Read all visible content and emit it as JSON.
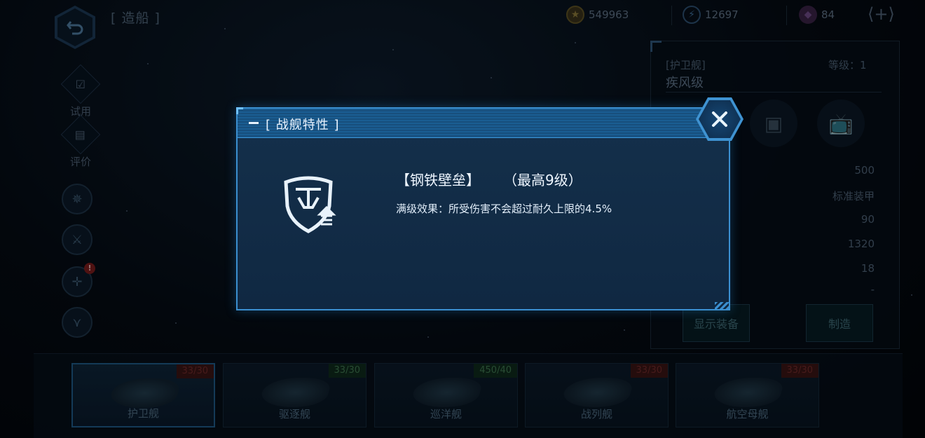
{
  "header": {
    "title": "[ 造船 ]",
    "resources": [
      {
        "name": "coin",
        "value": "549963"
      },
      {
        "name": "energy",
        "value": "12697"
      },
      {
        "name": "crystal",
        "value": "84"
      }
    ],
    "add_label": "+"
  },
  "left_menu": {
    "trial_label": "试用",
    "review_label": "评价",
    "alert_label": "!"
  },
  "ship_panel": {
    "type": "[护卫舰]",
    "level": "等级：1",
    "name": "疾风级",
    "stats": [
      "500",
      "标准装甲",
      "90",
      "1320",
      "18",
      "-"
    ],
    "show_equipment": "显示装备",
    "build": "制造"
  },
  "ship_tabs": [
    {
      "label": "护卫舰",
      "count": "33/30",
      "color": "red"
    },
    {
      "label": "驱逐舰",
      "count": "33/30",
      "color": "green"
    },
    {
      "label": "巡洋舰",
      "count": "450/40",
      "color": "green"
    },
    {
      "label": "战列舰",
      "count": "33/30",
      "color": "red"
    },
    {
      "label": "航空母舰",
      "count": "33/30",
      "color": "red"
    }
  ],
  "dialog": {
    "title": "[ 战舰特性 ]",
    "trait_name": "【钢铁壁垒】",
    "trait_max": "（最高9级）",
    "trait_desc": "满级效果：所受伤害不会超过耐久上限的4.5%"
  },
  "colors": {
    "dialog_border": "#3b8fd0",
    "dialog_header": "#1a5d92",
    "dialog_body": "#14304b",
    "accent_text": "#eef6ff"
  },
  "icons": [
    "back-arrow-icon",
    "coin-icon",
    "lightning-icon",
    "crystal-icon",
    "check-icon",
    "review-icon",
    "wings-icon",
    "swords-icon",
    "target-icon",
    "chevron-icon",
    "box-icon",
    "tv-icon",
    "close-icon",
    "shield-icon"
  ]
}
